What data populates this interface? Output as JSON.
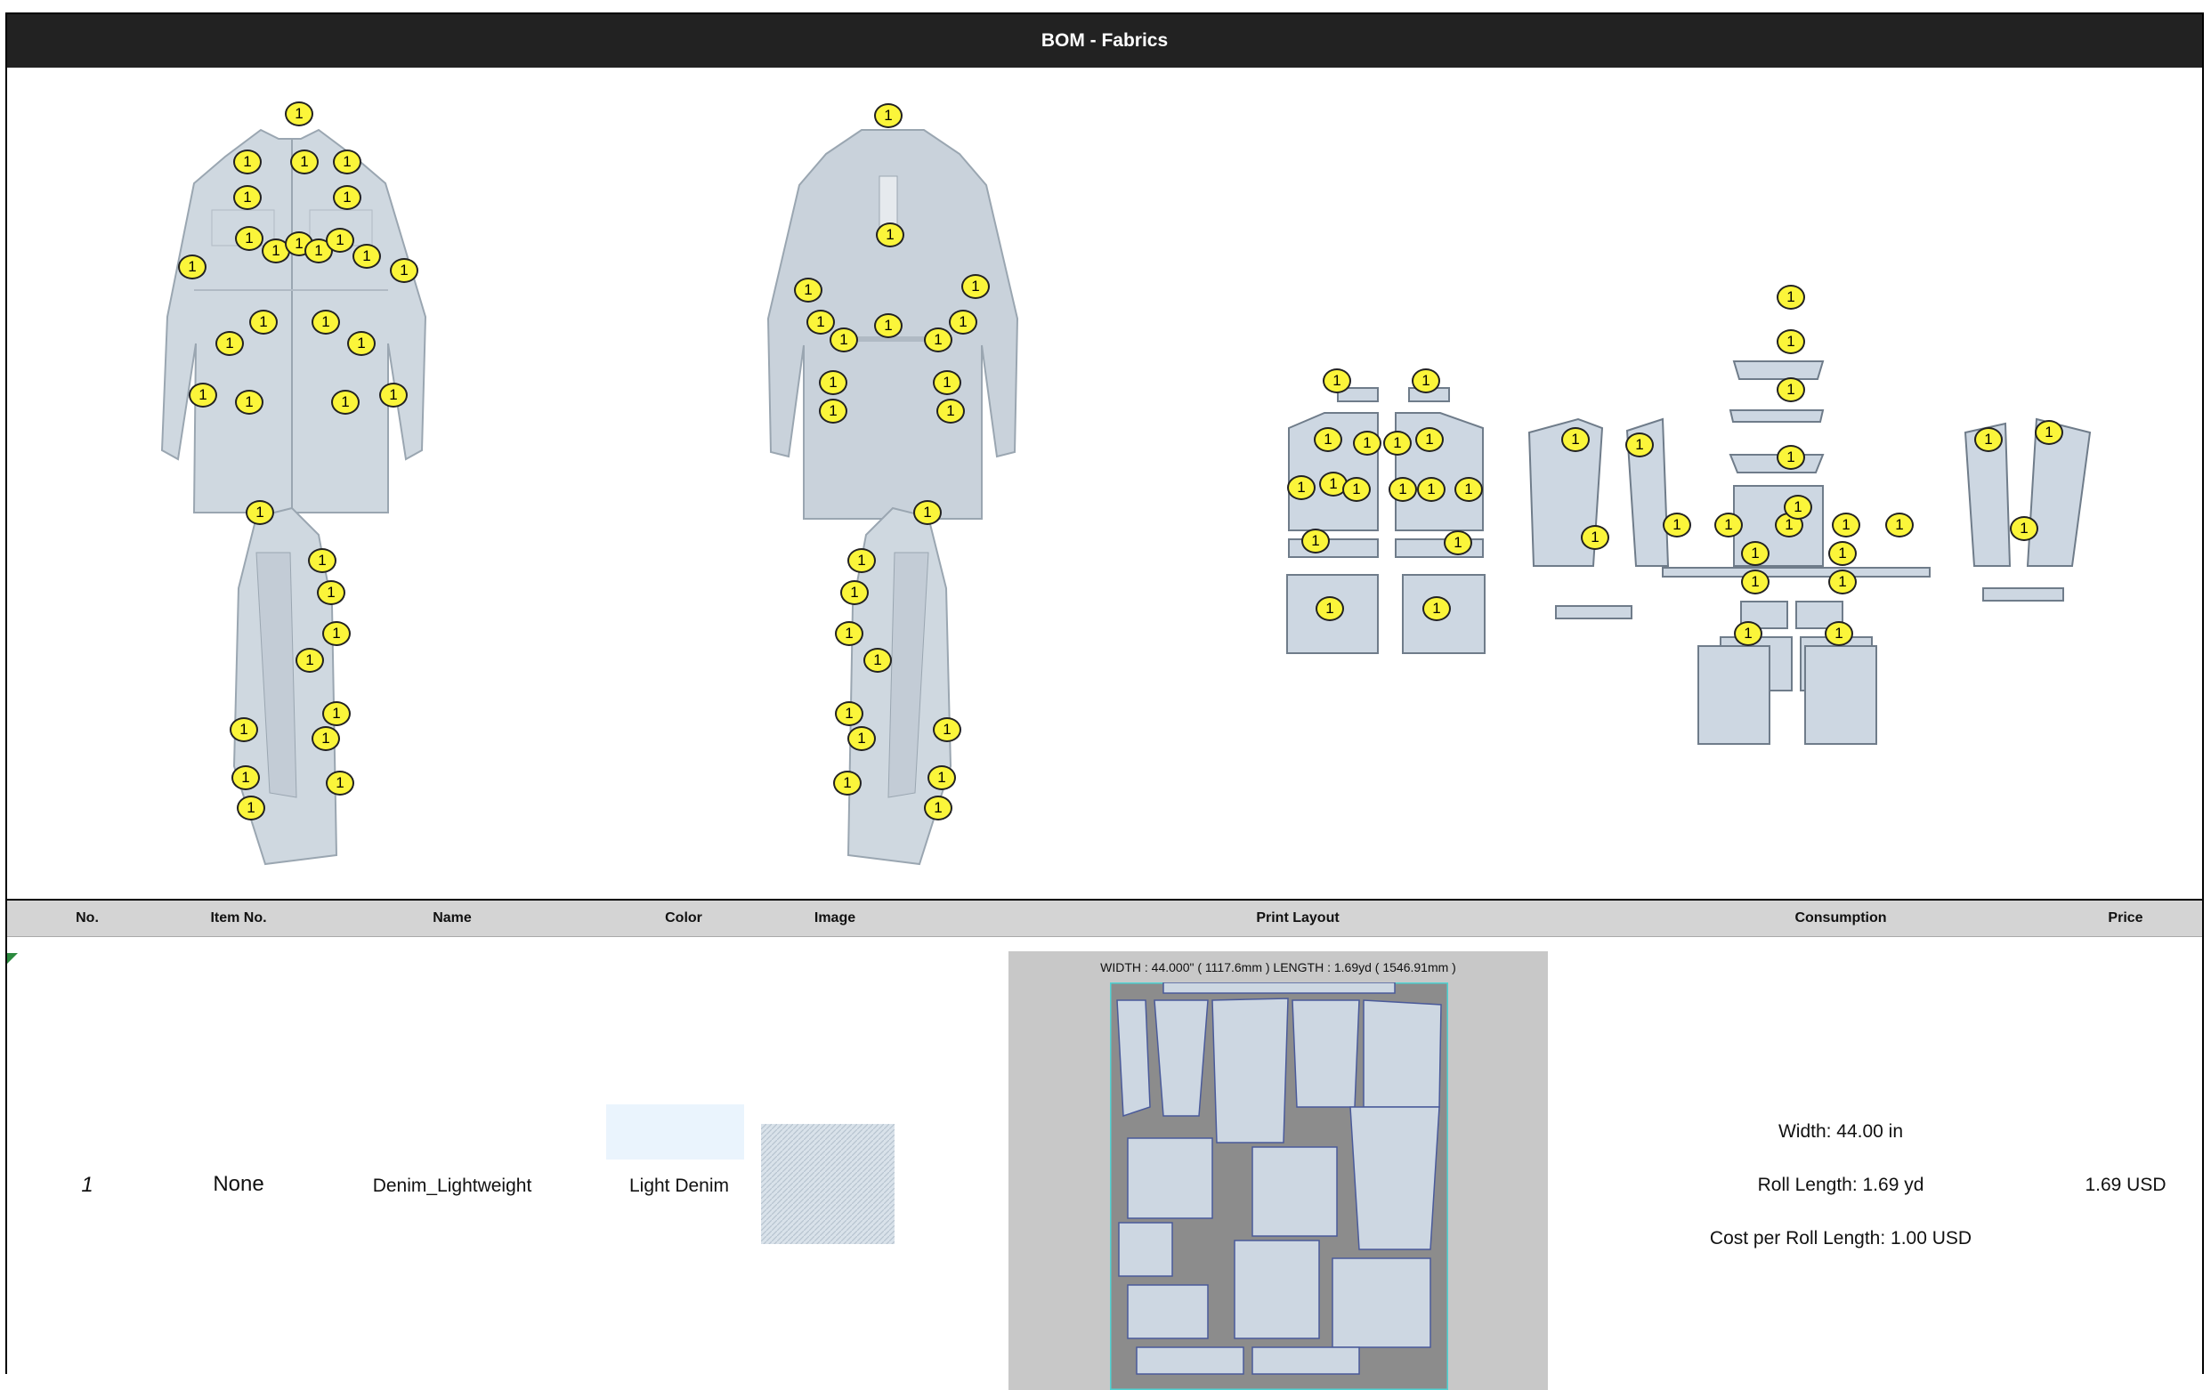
{
  "title": "BOM - Fabrics",
  "marker_label": "1",
  "table": {
    "headers": {
      "no": "No.",
      "item_no": "Item No.",
      "name": "Name",
      "color": "Color",
      "image": "Image",
      "print_layout": "Print Layout",
      "consumption": "Consumption",
      "price": "Price"
    },
    "rows": [
      {
        "no": "1",
        "item_no": "None",
        "name": "Denim_Lightweight",
        "color_name": "Light Denim",
        "color_hex": "#eaf4fd",
        "print_layout_dims": "WIDTH : 44.000\" ( 1117.6mm )    LENGTH : 1.69yd ( 1546.91mm )",
        "consumption": {
          "width": "Width: 44.00 in",
          "roll_length": "Roll Length: 1.69 yd",
          "cost_per_roll": "Cost per Roll Length: 1.00 USD"
        },
        "price": "1.69 USD"
      }
    ]
  },
  "colors": {
    "title_bar": "#222222",
    "header_row": "#d4d4d4",
    "marker": "#fbf53a",
    "denim": "#cfd8e0",
    "pattern_piece": "#cdd7e2"
  }
}
